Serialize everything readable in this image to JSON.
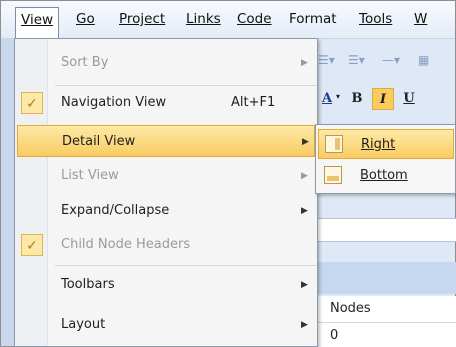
{
  "menubar": {
    "items": [
      {
        "label": "View",
        "u": "V"
      },
      {
        "label": "Go",
        "u": "G"
      },
      {
        "label": "Project",
        "u": "P"
      },
      {
        "label": "Links",
        "u": "L"
      },
      {
        "label": "Code",
        "u": "C"
      },
      {
        "label": "Format",
        "u": "o"
      },
      {
        "label": "Tools",
        "u": "T"
      },
      {
        "label": "W",
        "u": "W"
      }
    ]
  },
  "view_menu": {
    "items": [
      {
        "label": "Sort By",
        "state": "disabled",
        "submenu": true
      },
      {
        "label": "Navigation View",
        "checked": true,
        "shortcut": "Alt+F1"
      },
      {
        "label": "Detail View",
        "highlighted": true,
        "submenu": true
      },
      {
        "label": "List View",
        "state": "disabled",
        "submenu": true
      },
      {
        "label": "Expand/Collapse",
        "submenu": true
      },
      {
        "label": "Child Node Headers",
        "checked": true,
        "state": "disabled"
      },
      {
        "label": "Toolbars",
        "submenu": true
      },
      {
        "label": "Layout",
        "submenu": true
      }
    ]
  },
  "detail_submenu": {
    "items": [
      {
        "label": "Right",
        "highlighted": true,
        "icon": "layout-right-icon"
      },
      {
        "label": "Bottom",
        "icon": "layout-bottom-icon"
      }
    ]
  },
  "background": {
    "format_buttons": [
      "A",
      "B",
      "I",
      "U"
    ],
    "grid_header": "Nodes",
    "grid_value": "0"
  },
  "colors": {
    "highlight": "#f9cc62",
    "highlight_border": "#e3a93a",
    "check": "#fbe9a9"
  }
}
